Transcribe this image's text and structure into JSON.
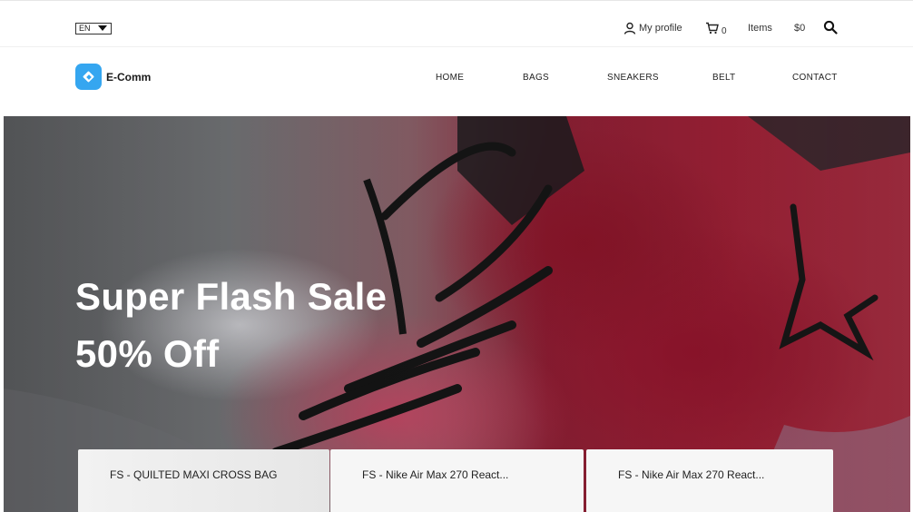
{
  "topbar": {
    "language": "EN",
    "profile_label": "My profile",
    "cart_count": "0",
    "items_label": "Items",
    "price": "$0"
  },
  "brand": {
    "name": "E-Comm",
    "color": "#35a6f0"
  },
  "nav": {
    "items": [
      {
        "label": "HOME"
      },
      {
        "label": "BAGS"
      },
      {
        "label": "SNEAKERS"
      },
      {
        "label": "BELT"
      },
      {
        "label": "CONTACT"
      }
    ]
  },
  "hero": {
    "title_line1": "Super Flash Sale",
    "title_line2": "50% Off",
    "cards": [
      {
        "label": "FS - QUILTED MAXI CROSS BAG"
      },
      {
        "label": "FS - Nike Air Max 270 React..."
      },
      {
        "label": "FS - Nike Air Max 270 React..."
      }
    ]
  }
}
